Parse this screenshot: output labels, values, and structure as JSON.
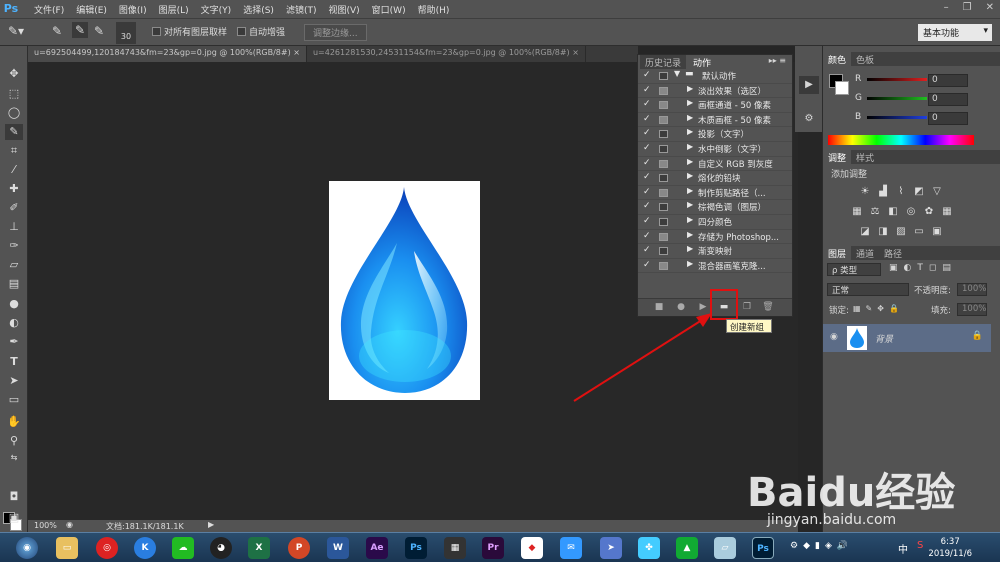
{
  "app": {
    "logo": "Ps"
  },
  "menu": [
    "文件(F)",
    "编辑(E)",
    "图像(I)",
    "图层(L)",
    "文字(Y)",
    "选择(S)",
    "滤镜(T)",
    "视图(V)",
    "窗口(W)",
    "帮助(H)"
  ],
  "window_controls": [
    "–",
    "❐",
    "✕"
  ],
  "options": {
    "brush_size": "30",
    "sample_all_label": "对所有图层取样",
    "auto_enhance_label": "自动增强",
    "refine_edge_label": "调整边缘...",
    "workspace": "基本功能"
  },
  "doc_tabs": [
    "u=692504499,120184743&fm=23&gp=0.jpg @ 100%(RGB/8#)",
    "u=4261281530,24531154&fm=23&gp=0.jpg @ 100%(RGB/8#)"
  ],
  "status": {
    "zoom": "100%",
    "doc_size": "文档:181.1K/181.1K"
  },
  "actions_panel": {
    "tabs": [
      "历史记录",
      "动作"
    ],
    "set_name": "默认动作",
    "items": [
      "淡出效果（选区）",
      "画框通道 - 50 像素",
      "木质画框 - 50 像素",
      "投影（文字）",
      "水中倒影（文字）",
      "自定义 RGB 到灰度",
      "熔化的铅块",
      "制作剪贴路径（...",
      "棕褐色调（图层）",
      "四分颜色",
      "存储为 Photoshop...",
      "渐变映射",
      "混合器画笔克隆..."
    ],
    "tooltip": "创建新组"
  },
  "color_panel": {
    "tabs": [
      "颜色",
      "色板"
    ],
    "channels": [
      {
        "label": "R",
        "value": "0",
        "color": "#e02020"
      },
      {
        "label": "G",
        "value": "0",
        "color": "#20c020"
      },
      {
        "label": "B",
        "value": "0",
        "color": "#2040e0"
      }
    ]
  },
  "adjust_panel": {
    "tabs": [
      "调整",
      "样式"
    ],
    "title": "添加调整"
  },
  "layers_panel": {
    "tabs": [
      "图层",
      "通道",
      "路径"
    ],
    "filter": "ρ 类型",
    "blend_mode": "正常",
    "opacity_label": "不透明度:",
    "opacity_value": "100%",
    "lock_label": "锁定:",
    "fill_label": "填充:",
    "fill_value": "100%",
    "layer_name": "背景"
  },
  "taskbar": {
    "time": "6:37",
    "date": "2019/11/6",
    "ime": "中"
  },
  "watermark": {
    "brand": "Baidu经验",
    "url": "jingyan.baidu.com"
  }
}
